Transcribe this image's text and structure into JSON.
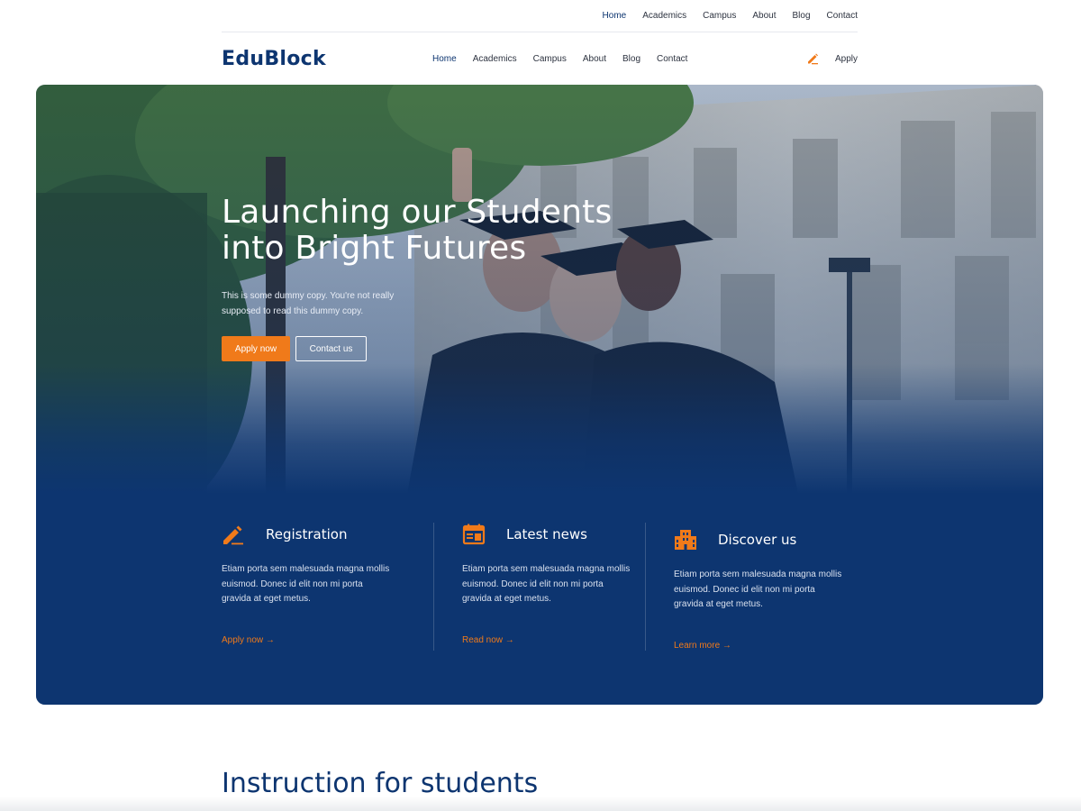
{
  "topnav": {
    "items": [
      "Home",
      "Academics",
      "Campus",
      "About",
      "Blog",
      "Contact"
    ],
    "active": "Home"
  },
  "header": {
    "logo": "EduBlock",
    "nav": [
      "Home",
      "Academics",
      "Campus",
      "About",
      "Blog",
      "Contact"
    ],
    "active": "Home",
    "apply_label": "Apply",
    "apply_icon": "pencil-icon"
  },
  "hero": {
    "title": "Launching our Students into Bright Futures",
    "subtitle": "This is some dummy copy. You're not really supposed to read this dummy copy.",
    "primary_button": "Apply now",
    "secondary_button": "Contact us",
    "image": "graduates-selfie-photo"
  },
  "features": [
    {
      "icon": "pencil-edit-icon",
      "title": "Registration",
      "text": "Etiam porta sem malesuada magna mollis euismod. Donec id elit non mi porta gravida at eget metus.",
      "link": "Apply now →"
    },
    {
      "icon": "calendar-icon",
      "title": "Latest news",
      "text": "Etiam porta sem malesuada magna mollis euismod. Donec id elit non mi porta gravida at eget metus.",
      "link": "Read now →"
    },
    {
      "icon": "building-icon",
      "title": "Discover us",
      "text": "Etiam porta sem malesuada magna mollis euismod. Donec id elit non mi porta gravida at eget metus.",
      "link": "Learn more →"
    }
  ],
  "section": {
    "heading": "Instruction for students"
  },
  "colors": {
    "brand_navy": "#0d3570",
    "accent_orange": "#f07a1a",
    "text_dark": "#2d3340",
    "white": "#ffffff"
  }
}
